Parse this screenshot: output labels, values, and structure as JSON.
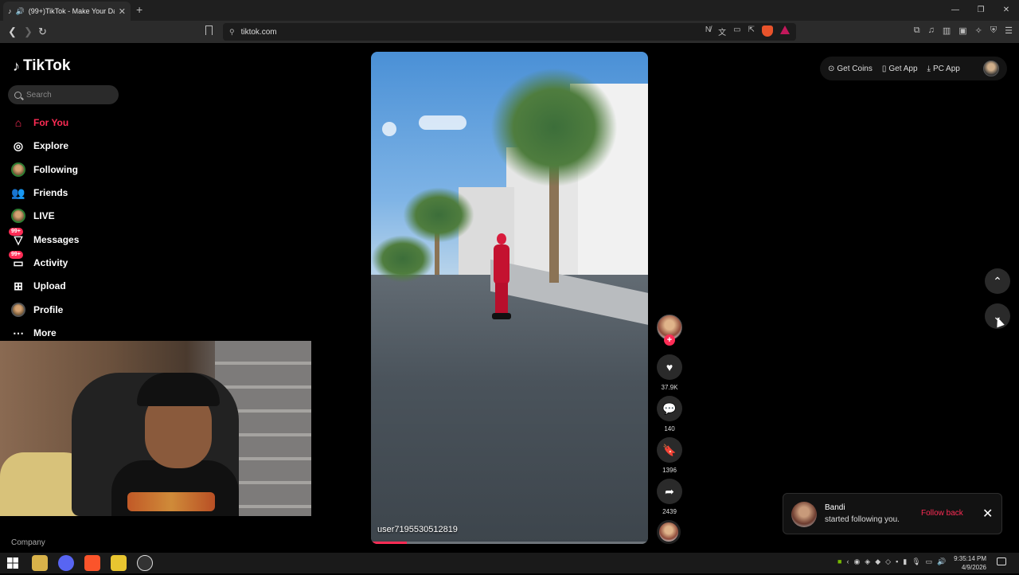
{
  "browser": {
    "tab_title": "(99+)TikTok - Make Your Day",
    "tab_close": "✕",
    "new_tab": "+",
    "url": "tiktok.com",
    "window_controls": [
      "—",
      "❐",
      "✕"
    ]
  },
  "tiktok": {
    "logo_text": "TikTok",
    "search_placeholder": "Search",
    "menu": [
      {
        "label": "For You",
        "icon": "home-icon"
      },
      {
        "label": "Explore",
        "icon": "compass-icon"
      },
      {
        "label": "Following",
        "icon": "avatar-icon"
      },
      {
        "label": "Friends",
        "icon": "friends-icon"
      },
      {
        "label": "LIVE",
        "icon": "avatar-icon"
      },
      {
        "label": "Messages",
        "icon": "messages-icon",
        "badge": "99+"
      },
      {
        "label": "Activity",
        "icon": "activity-icon",
        "badge": "99+"
      },
      {
        "label": "Upload",
        "icon": "upload-icon"
      },
      {
        "label": "Profile",
        "icon": "profile-icon"
      },
      {
        "label": "More",
        "icon": "more-icon"
      }
    ],
    "company_label": "Company",
    "topbar": {
      "get_coins": "Get Coins",
      "get_app": "Get App",
      "pc_app": "PC App"
    },
    "video": {
      "username": "user7195530512819",
      "progress": 0.13
    },
    "actions": {
      "likes": "37.9K",
      "comments": "140",
      "saves": "1396",
      "shares": "2439"
    },
    "toast": {
      "name": "Bandi",
      "message": "started following you.",
      "follow_back": "Follow back",
      "close": "✕"
    }
  },
  "taskbar": {
    "time": "9:35:14 PM",
    "date": "4/9/2026"
  },
  "colors": {
    "accent": "#fe2c55",
    "background": "#000000"
  }
}
